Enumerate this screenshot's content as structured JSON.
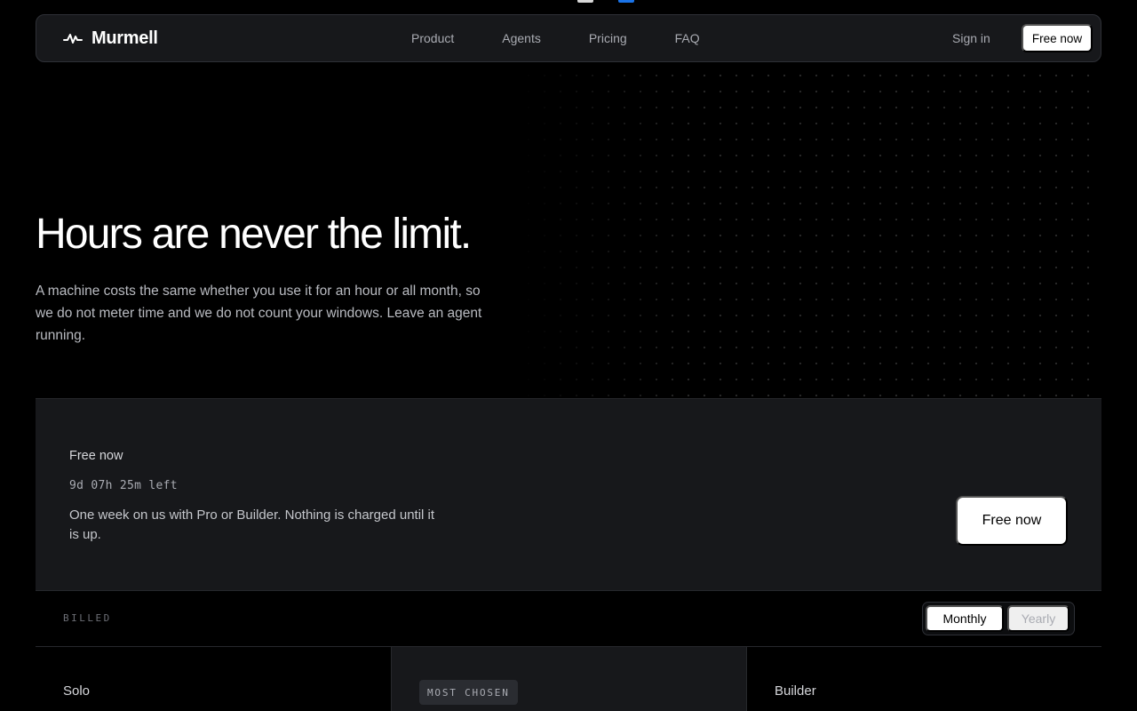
{
  "nav": {
    "brand": "Murmell",
    "links": [
      "Product",
      "Agents",
      "Pricing",
      "FAQ"
    ],
    "signin": "Sign in",
    "cta": "Free now"
  },
  "hero": {
    "title": "Hours are never the limit.",
    "subtitle": "A machine costs the same whether you use it for an hour or all month, so we do not meter time and we do not count your windows. Leave an agent running."
  },
  "promo": {
    "label": "Free now",
    "timer": "9d 07h 25m left",
    "description": "One week on us with Pro or Builder. Nothing is charged until it is up.",
    "cta": "Free now"
  },
  "billing": {
    "label": "BILLED",
    "options": [
      "Monthly",
      "Yearly"
    ],
    "selected": "Monthly"
  },
  "plans": {
    "solo": "Solo",
    "badge": "MOST CHOSEN",
    "builder": "Builder"
  },
  "icons": {
    "brand": "pulse-wave-icon"
  },
  "colors": {
    "background": "#000000",
    "panel": "#17181b",
    "accent_button": "#ffffff"
  }
}
